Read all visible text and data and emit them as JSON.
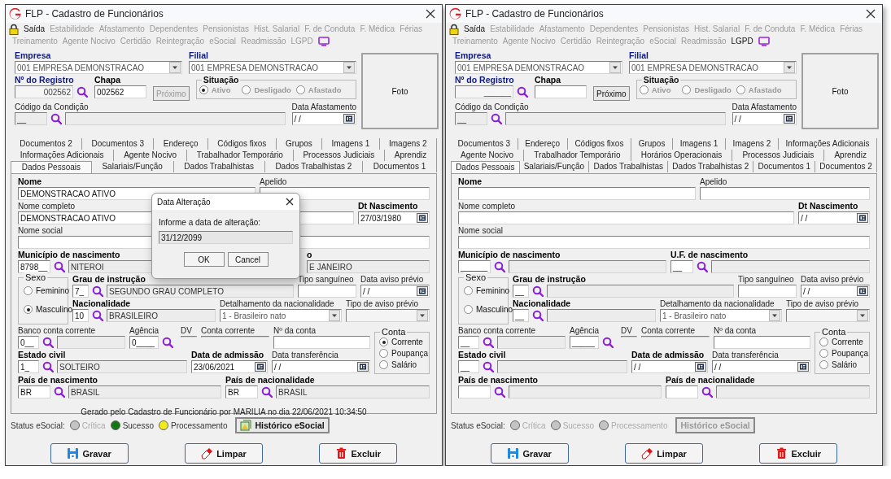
{
  "windows": [
    {
      "title": "FLP - Cadastro de Funcionários",
      "menu": [
        [
          {
            "label": "Saída",
            "disabled": false
          },
          {
            "label": "Estabilidade",
            "disabled": true
          },
          {
            "label": "Afastamento",
            "disabled": true
          },
          {
            "label": "Dependentes",
            "disabled": true
          },
          {
            "label": "Pensionistas",
            "disabled": true
          },
          {
            "label": "Hist. Salarial",
            "disabled": true
          },
          {
            "label": "F. de Conduta",
            "disabled": true
          },
          {
            "label": "F. Médica",
            "disabled": true
          },
          {
            "label": "Férias",
            "disabled": true
          }
        ],
        [
          {
            "label": "Treinamento",
            "disabled": true
          },
          {
            "label": "Agente Nocivo",
            "disabled": true
          },
          {
            "label": "Certidão",
            "disabled": true
          },
          {
            "label": "Reintegração",
            "disabled": true
          },
          {
            "label": "eSocial",
            "disabled": true
          },
          {
            "label": "Readmissão",
            "disabled": true
          },
          {
            "label": "LGPD",
            "disabled": true
          }
        ]
      ],
      "header": {
        "empresa": {
          "label": "Empresa",
          "value": "001 EMPRESA DEMONSTRACAO"
        },
        "filial": {
          "label": "Filial",
          "value": "001 EMPRESA DEMONSTRACAO"
        },
        "registro": {
          "label": "Nº do Registro",
          "value": "002562"
        },
        "chapa": {
          "label": "Chapa",
          "value": "002562"
        },
        "proximo": {
          "label": "Próximo",
          "disabled": true
        },
        "situacao": {
          "label": "Situação",
          "options": [
            {
              "label": "Ativo",
              "selected": true
            },
            {
              "label": "Desligado",
              "selected": false
            },
            {
              "label": "Afastado",
              "selected": false
            }
          ]
        },
        "condicao": {
          "label": "Código da Condição",
          "code": "__"
        },
        "afastamento": {
          "label": "Data Afastamento",
          "value": "/ /"
        },
        "foto": "Foto"
      },
      "tab_rows": [
        [
          {
            "label": "Documentos 2",
            "selected": false
          },
          {
            "label": "Documentos 3",
            "selected": false
          },
          {
            "label": "Endereço",
            "selected": false
          },
          {
            "label": "Códigos fixos",
            "selected": false
          },
          {
            "label": "Grupos",
            "selected": false
          },
          {
            "label": "Imagens 1",
            "selected": false
          },
          {
            "label": "Imagens 2",
            "selected": false
          }
        ],
        [
          {
            "label": "Informações Adicionais",
            "selected": false
          },
          {
            "label": "Agente Nocivo",
            "selected": false
          },
          {
            "label": "Trabalhador Temporário",
            "selected": false
          },
          {
            "label": "Processos Judiciais",
            "selected": false
          },
          {
            "label": "Aprendiz",
            "selected": false
          }
        ],
        [
          {
            "label": "Dados Pessoais",
            "selected": true
          },
          {
            "label": "Salariais/Função",
            "selected": false
          },
          {
            "label": "Dados Trabalhistas",
            "selected": false
          },
          {
            "label": "Dados Trabalhistas 2",
            "selected": false
          },
          {
            "label": "Documentos 1",
            "selected": false
          }
        ]
      ],
      "form": {
        "nome": {
          "label": "Nome",
          "value": "DEMONSTRACAO ATIVO"
        },
        "apelido": {
          "label": "Apelido"
        },
        "nome_completo": {
          "label": "Nome completo",
          "value": "DEMONSTRACAO ATIVO"
        },
        "dt_nascimento": {
          "label": "Dt Nascimento",
          "value": "27/03/1980"
        },
        "nome_social": {
          "label": "Nome social"
        },
        "municipio": {
          "label": "Município de nascimento",
          "code": "8798__",
          "description": "NITEROI"
        },
        "uf": {
          "label": "o",
          "description": "E JANEIRO",
          "cut": true
        },
        "sexo": {
          "label": "Sexo",
          "options": [
            {
              "label": "Feminino",
              "selected": false
            },
            {
              "label": "Masculino",
              "selected": true
            }
          ]
        },
        "grau": {
          "label": "Grau de instrução",
          "code": "7_",
          "description": "SEGUNDO GRAU COMPLETO"
        },
        "tipo_sanguineo": {
          "label": "Tipo sanguíneo"
        },
        "data_aviso": {
          "label": "Data aviso prévio",
          "value": "/ /"
        },
        "nacionalidade": {
          "label": "Nacionalidade",
          "code": "10",
          "description": "BRASILEIRO"
        },
        "detalhamento": {
          "label": "Detalhamento da nacionalidade",
          "value": "1 - Brasileiro nato"
        },
        "tipo_aviso": {
          "label": "Tipo de aviso prévio"
        },
        "banco": {
          "label": "Banco conta corrente",
          "code": "0__"
        },
        "agencia": {
          "label": "Agência",
          "code": "0____"
        },
        "dv": {
          "label": "DV"
        },
        "conta_corrente": {
          "label": "Conta corrente"
        },
        "numero_conta": {
          "label": "Nº da conta"
        },
        "conta": {
          "label": "Conta",
          "options": [
            {
              "label": "Corrente",
              "selected": true
            },
            {
              "label": "Poupança",
              "selected": false
            },
            {
              "label": "Salário",
              "selected": false
            }
          ]
        },
        "estado_civil": {
          "label": "Estado civil",
          "code": "1_",
          "description": "SOLTEIRO"
        },
        "admissao": {
          "label": "Data de admissão",
          "value": "23/06/2021"
        },
        "transferencia": {
          "label": "Data transferência",
          "value": "/ /"
        },
        "pais_nascimento": {
          "label": "País de nascimento",
          "code": "BR",
          "description": "BRASIL"
        },
        "pais_nacionalidade": {
          "label": "País de nacionalidade",
          "code": "BR",
          "description": "BRASIL"
        },
        "note": "Gerado pelo Cadastro de Funcionário por MARILIA no dia 22/06/2021 10:34:50"
      },
      "status": {
        "label": "Status eSocial:",
        "items": [
          {
            "label": "Crítica",
            "color": "#c4c4c4",
            "disabled": true
          },
          {
            "label": "Sucesso",
            "color": "#137a13",
            "disabled": false
          },
          {
            "label": "Processamento",
            "color": "#f2ea1a",
            "disabled": false
          }
        ],
        "history": {
          "label": "Histórico eSocial",
          "disabled": false
        }
      },
      "buttons": [
        {
          "label": "Gravar",
          "kind": "save"
        },
        {
          "label": "Limpar",
          "kind": "clear"
        },
        {
          "label": "Excluir",
          "kind": "delete"
        }
      ],
      "dialog": {
        "title": "Data Alteração",
        "prompt": "Informe a data de alteração:",
        "value": "31/12/2099",
        "buttons": [
          "OK",
          "Cancel"
        ]
      }
    },
    {
      "title": "FLP - Cadastro de Funcionários",
      "menu": [
        [
          {
            "label": "Saída",
            "disabled": false
          },
          {
            "label": "Estabilidade",
            "disabled": true
          },
          {
            "label": "Afastamento",
            "disabled": true
          },
          {
            "label": "Dependentes",
            "disabled": true
          },
          {
            "label": "Pensionistas",
            "disabled": true
          },
          {
            "label": "Hist. Salarial",
            "disabled": true
          },
          {
            "label": "F. de Conduta",
            "disabled": true
          },
          {
            "label": "F. Médica",
            "disabled": true
          },
          {
            "label": "Férias",
            "disabled": true
          }
        ],
        [
          {
            "label": "Treinamento",
            "disabled": true
          },
          {
            "label": "Agente Nocivo",
            "disabled": true
          },
          {
            "label": "Certidão",
            "disabled": true
          },
          {
            "label": "Reintegração",
            "disabled": true
          },
          {
            "label": "eSocial",
            "disabled": true
          },
          {
            "label": "Readmissão",
            "disabled": true
          },
          {
            "label": "LGPD",
            "disabled": false
          }
        ]
      ],
      "header": {
        "empresa": {
          "label": "Empresa",
          "value": "001 EMPRESA DEMONSTRACAO"
        },
        "filial": {
          "label": "Filial",
          "value": "001 EMPRESA DEMONSTRACAO"
        },
        "registro": {
          "label": "Nº do Registro",
          "value": "______"
        },
        "chapa": {
          "label": "Chapa"
        },
        "proximo": {
          "label": "Próximo",
          "disabled": false
        },
        "situacao": {
          "label": "Situação",
          "options": [
            {
              "label": "Ativo",
              "selected": false
            },
            {
              "label": "Desligado",
              "selected": false
            },
            {
              "label": "Afastado",
              "selected": false
            }
          ]
        },
        "condicao": {
          "label": "Código da Condição",
          "code": "__"
        },
        "afastamento": {
          "label": "Data Afastamento",
          "value": "/ /"
        },
        "foto": "Foto"
      },
      "tab_rows": [
        [
          {
            "label": "Documentos 3",
            "selected": false
          },
          {
            "label": "Endereço",
            "selected": false
          },
          {
            "label": "Códigos fixos",
            "selected": false
          },
          {
            "label": "Grupos",
            "selected": false
          },
          {
            "label": "Imagens 1",
            "selected": false
          },
          {
            "label": "Imagens 2",
            "selected": false
          },
          {
            "label": "Informações Adicionais",
            "selected": false
          }
        ],
        [
          {
            "label": "Agente Nocivo",
            "selected": false
          },
          {
            "label": "Trabalhador Temporário",
            "selected": false
          },
          {
            "label": "Horários Operacionais",
            "selected": false
          },
          {
            "label": "Processos Judiciais",
            "selected": false
          },
          {
            "label": "Aprendiz",
            "selected": false
          }
        ],
        [
          {
            "label": "Dados Pessoais",
            "selected": true
          },
          {
            "label": "Salariais/Função",
            "selected": false
          },
          {
            "label": "Dados Trabalhistas",
            "selected": false
          },
          {
            "label": "Dados Trabalhistas 2",
            "selected": false
          },
          {
            "label": "Documentos 1",
            "selected": false
          },
          {
            "label": "Documentos 2",
            "selected": false
          }
        ]
      ],
      "form": {
        "nome": {
          "label": "Nome"
        },
        "apelido": {
          "label": "Apelido"
        },
        "nome_completo": {
          "label": "Nome completo"
        },
        "dt_nascimento": {
          "label": "Dt Nascimento",
          "value": "/ /"
        },
        "nome_social": {
          "label": "Nome social"
        },
        "municipio": {
          "label": "Município de nascimento",
          "code": "______"
        },
        "uf": {
          "label": "U.F. de nascimento",
          "code": "__",
          "cut": false
        },
        "sexo": {
          "label": "Sexo",
          "options": [
            {
              "label": "Feminino",
              "selected": false
            },
            {
              "label": "Masculino",
              "selected": false
            }
          ]
        },
        "grau": {
          "label": "Grau de instrução",
          "code": "__"
        },
        "tipo_sanguineo": {
          "label": "Tipo sanguíneo"
        },
        "data_aviso": {
          "label": "Data aviso prévio",
          "value": "/ /"
        },
        "nacionalidade": {
          "label": "Nacionalidade",
          "code": "__"
        },
        "detalhamento": {
          "label": "Detalhamento da nacionalidade",
          "value": "1 - Brasileiro nato"
        },
        "tipo_aviso": {
          "label": "Tipo de aviso prévio"
        },
        "banco": {
          "label": "Banco conta corrente",
          "code": "__"
        },
        "agencia": {
          "label": "Agência",
          "code": "_____"
        },
        "dv": {
          "label": "DV"
        },
        "conta_corrente": {
          "label": "Conta corrente"
        },
        "numero_conta": {
          "label": "Nº da conta"
        },
        "conta": {
          "label": "Conta",
          "options": [
            {
              "label": "Corrente",
              "selected": false
            },
            {
              "label": "Poupança",
              "selected": false
            },
            {
              "label": "Salário",
              "selected": false
            }
          ]
        },
        "estado_civil": {
          "label": "Estado civil",
          "code": "__"
        },
        "admissao": {
          "label": "Data de admissão",
          "value": "/ /"
        },
        "transferencia": {
          "label": "Data transferência",
          "value": "/ /"
        },
        "pais_nascimento": {
          "label": "País de nascimento"
        },
        "pais_nacionalidade": {
          "label": "País de nacionalidade"
        }
      },
      "status": {
        "label": "Status eSocial:",
        "items": [
          {
            "label": "Crítica",
            "color": "#c4c4c4",
            "disabled": true
          },
          {
            "label": "Sucesso",
            "color": "#c4c4c4",
            "disabled": true
          },
          {
            "label": "Processamento",
            "color": "#c4c4c4",
            "disabled": true
          }
        ],
        "history": {
          "label": "Histórico eSocial",
          "disabled": true
        }
      },
      "buttons": [
        {
          "label": "Gravar",
          "kind": "save"
        },
        {
          "label": "Limpar",
          "kind": "clear"
        },
        {
          "label": "Excluir",
          "kind": "delete"
        }
      ]
    }
  ]
}
